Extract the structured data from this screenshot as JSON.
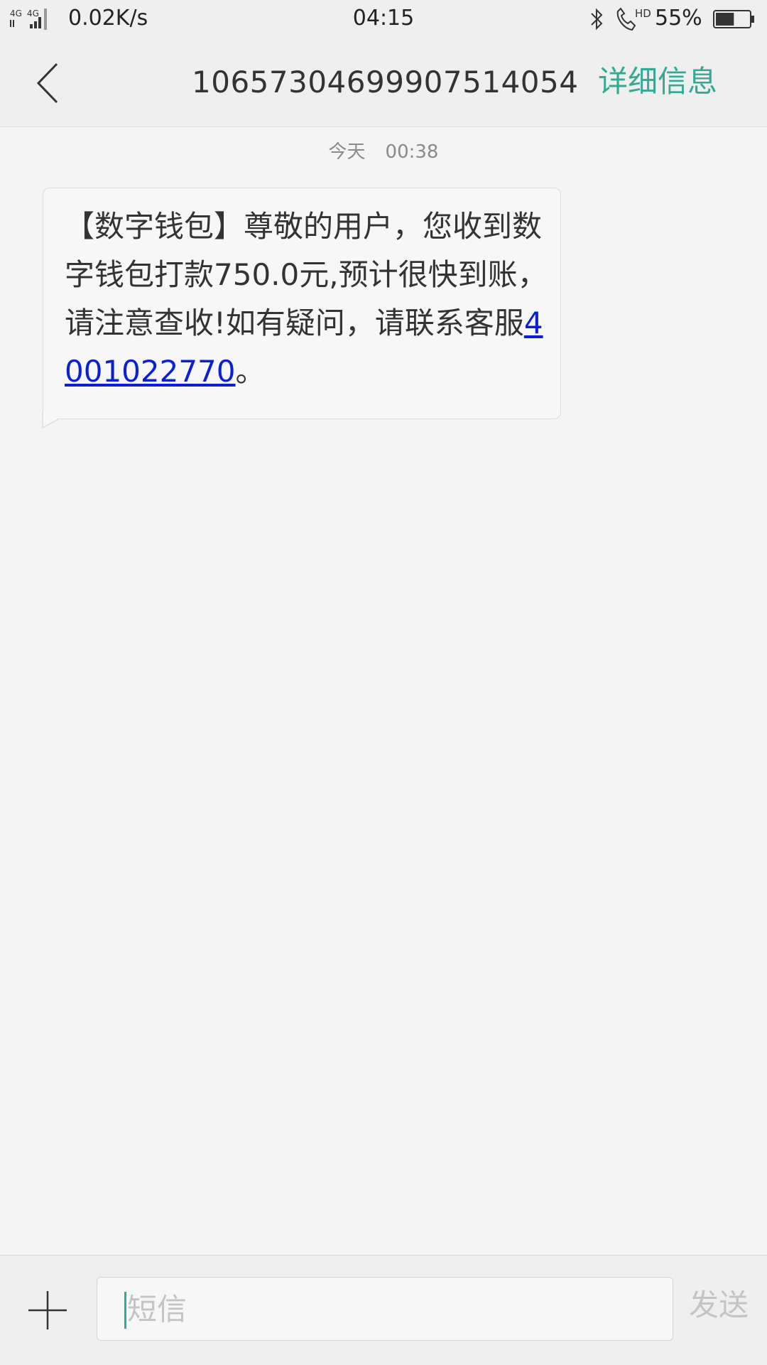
{
  "status_bar": {
    "network": "4G 4G",
    "speed": "0.02K/s",
    "time": "04:15",
    "hd_label": "HD",
    "battery_text": "55%",
    "battery_level": 0.55
  },
  "header": {
    "contact": "10657304699907514054",
    "details_label": "详细信息",
    "accent_color": "#34aa94"
  },
  "conversation": {
    "date_label": "今天",
    "time_label": "00:38",
    "message": {
      "text_before_link": "【数字钱包】尊敬的用户，您收到数字钱包打款750.0元,预计很快到账，请注意查收!如有疑问，请联系客服",
      "link": "4001022770",
      "text_after_link": "。"
    }
  },
  "composer": {
    "placeholder": "短信",
    "send_label": "发送"
  }
}
